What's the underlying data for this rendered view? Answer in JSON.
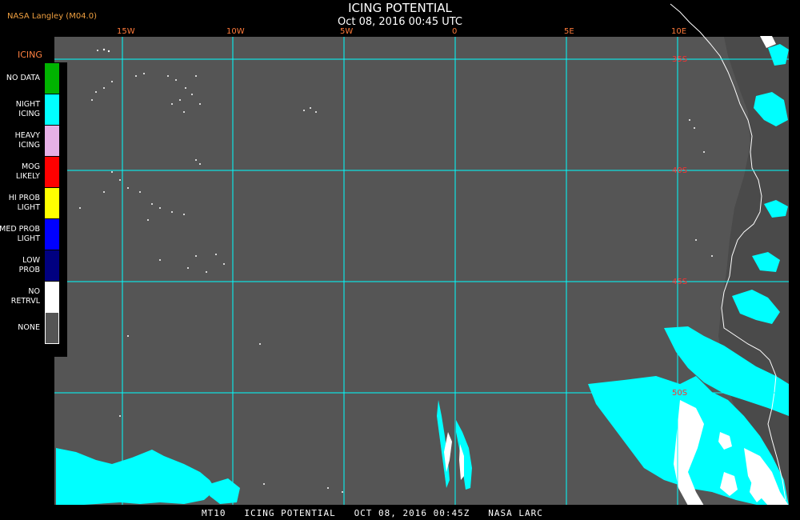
{
  "header": {
    "title": "ICING POTENTIAL",
    "subtitle": "Oct 08, 2016 00:45 UTC",
    "agency": "NASA Langley (M04.0)"
  },
  "map": {
    "lon_labels": [
      "15W",
      "10W",
      "5W",
      "0",
      "5E",
      "10E"
    ],
    "lat_labels": [
      "35S",
      "40S",
      "45S",
      "50S"
    ]
  },
  "legend": {
    "title": "ICING",
    "items": [
      {
        "label": "NO DATA",
        "color": "#00b400"
      },
      {
        "label": "NIGHT ICING",
        "color": "#00ffff"
      },
      {
        "label": "HEAVY ICING",
        "color": "#e6b0e6"
      },
      {
        "label": "MOG LIKELY",
        "color": "#ff0000"
      },
      {
        "label": "HI PROB LIGHT",
        "color": "#ffff00"
      },
      {
        "label": "MED PROB LIGHT",
        "color": "#0000ff"
      },
      {
        "label": "LOW PROB",
        "color": "#000080"
      },
      {
        "label": "NO RETRVL",
        "color": "#ffffff"
      },
      {
        "label": "NONE",
        "color": "#555555"
      }
    ]
  },
  "footer": {
    "text": "MT10   ICING POTENTIAL   OCT 08, 2016 00:45Z   NASA LARC"
  },
  "colors": {
    "background": "#555555",
    "grid": "#00ffff",
    "coast": "#ffffff",
    "lat_label": "#ff3030",
    "lon_label": "#ff7a3a"
  }
}
